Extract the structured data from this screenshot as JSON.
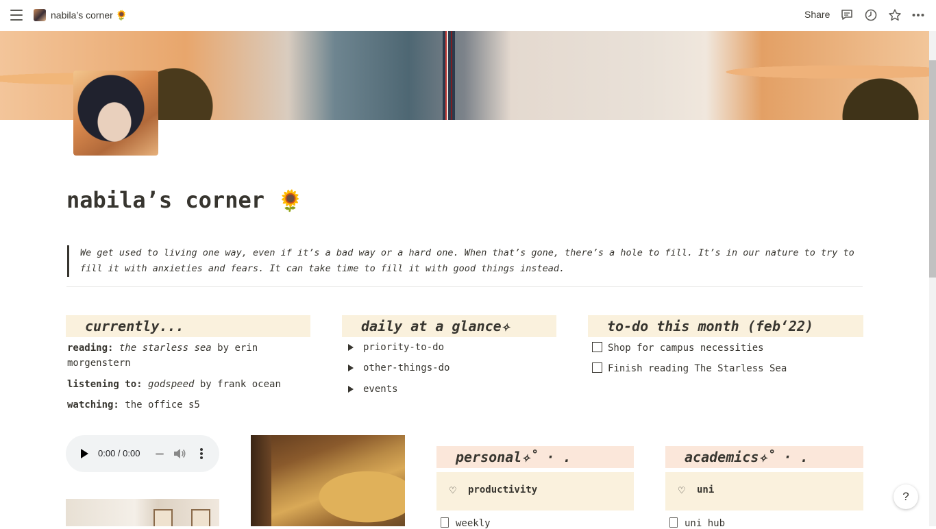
{
  "topbar": {
    "title": "nabila’s corner 🌻",
    "share_label": "Share",
    "icons": [
      "menu-icon",
      "comment-icon",
      "clock-icon",
      "star-icon",
      "more-icon"
    ]
  },
  "page": {
    "title": "nabila’s corner",
    "title_emoji": "🌻",
    "quote": "We get used to living one way, even if it’s a bad way or a hard one. When that’s gone, there’s a hole to fill. It’s in our nature to try to fill it with anxieties and fears. It can take time to fill it with good things instead."
  },
  "currently": {
    "heading": "currently...",
    "reading_label": "reading:",
    "reading_title": "the starless sea",
    "reading_by": " by erin",
    "reading_author_cont": "morgenstern",
    "listening_label": "listening to:",
    "listening_title": "godspeed",
    "listening_by": " by frank ocean",
    "watching_label": "watching:",
    "watching_value": " the office s5"
  },
  "daily": {
    "heading": "daily at a glance✧",
    "toggles": [
      "priority-to-do",
      "other-things-do",
      "events"
    ]
  },
  "todo": {
    "heading": "to-do this month (feb‘22)",
    "items": [
      {
        "text": "Shop for campus necessities",
        "checked": false
      },
      {
        "text": "Finish reading The Starless Sea",
        "checked": false
      }
    ]
  },
  "audio": {
    "time": "0:00 / 0:00"
  },
  "personal": {
    "heading": "personal✧˚ · .",
    "tile_icon": "♡",
    "tile_label": "productivity",
    "link": "weekly"
  },
  "academics": {
    "heading": "academics✧˚ · .",
    "tile_icon": "♡",
    "tile_label": "uni",
    "link": "uni hub"
  },
  "help_label": "?",
  "colors": {
    "text": "#37352f",
    "section_yellow": "#faf1dd",
    "section_pink": "#fbe7da"
  }
}
